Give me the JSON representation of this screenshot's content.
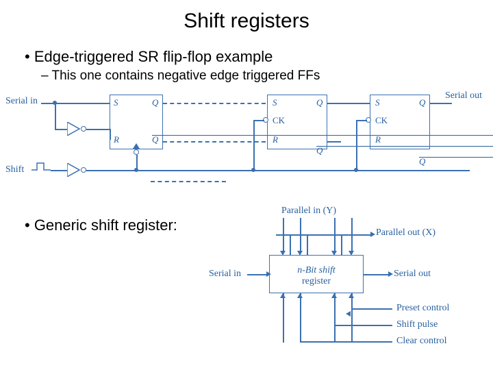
{
  "title": "Shift registers",
  "bullet1": "• Edge-triggered SR flip-flop example",
  "bullet1_sub": "– This one contains negative edge triggered FFs",
  "bullet2": "• Generic shift register:",
  "diagram1": {
    "serial_in": "Serial in",
    "shift": "Shift",
    "serial_out": "Serial out",
    "S": "S",
    "R": "R",
    "Q": "Q",
    "Qbar": "Q",
    "CK": "CK"
  },
  "diagram2": {
    "title_top": "Parallel in (Y)",
    "parallel_out": "Parallel out (X)",
    "serial_in": "Serial in",
    "serial_out": "Serial out",
    "box_line1": "n-Bit shift",
    "box_line2": "register",
    "preset": "Preset control",
    "shift_pulse": "Shift pulse",
    "clear": "Clear control"
  }
}
